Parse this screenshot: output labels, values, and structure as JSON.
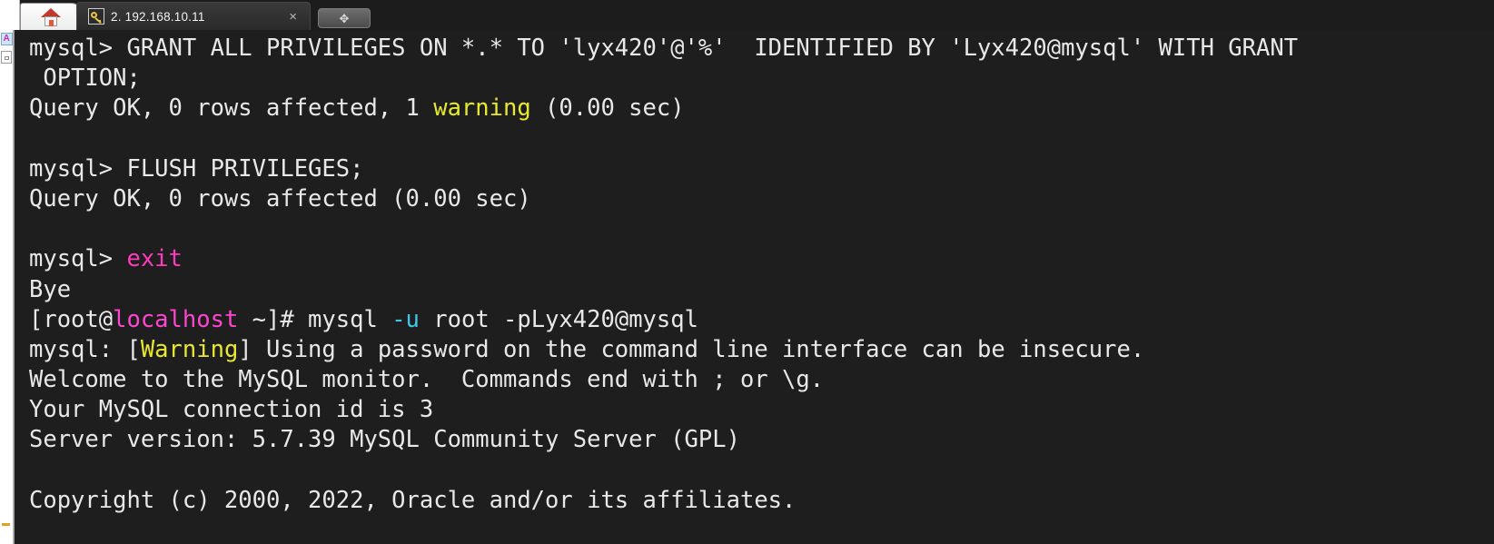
{
  "window": {
    "background_color": "#1c1c1c",
    "terminal_bg": "#1e1e1e",
    "terminal_fg": "#e6e6e6"
  },
  "tabbar": {
    "home_tab": {
      "label": "",
      "icon": "home-icon",
      "tooltip": "Home"
    },
    "session_tab": {
      "label": "2. 192.168.10.11",
      "icon": "key-icon",
      "close_label": "×",
      "active": true
    },
    "new_tab": {
      "label": "✥",
      "icon": "new-tab-icon"
    }
  },
  "sidebar": {
    "items": [
      {
        "name": "session-manager-icon",
        "label": "A"
      },
      {
        "name": "panel-icon",
        "label": ""
      }
    ]
  },
  "terminal": {
    "lines": [
      {
        "id": "line-grant",
        "segments": [
          {
            "text": "mysql> GRANT ALL PRIVILEGES ON *.* TO 'lyx420'@'%'  IDENTIFIED BY 'Lyx420@mysql' WITH GRANT",
            "color": "white"
          }
        ]
      },
      {
        "id": "line-grant-wrap",
        "segments": [
          {
            "text": " OPTION;",
            "color": "white"
          }
        ]
      },
      {
        "id": "line-queryok-warning",
        "segments": [
          {
            "text": "Query OK, 0 rows affected, 1 ",
            "color": "white"
          },
          {
            "text": "warning",
            "color": "yellow"
          },
          {
            "text": " (0.00 sec)",
            "color": "white"
          }
        ]
      },
      {
        "id": "line-blank-1",
        "segments": [
          {
            "text": "",
            "color": "white"
          }
        ]
      },
      {
        "id": "line-flush",
        "segments": [
          {
            "text": "mysql> FLUSH PRIVILEGES;",
            "color": "white"
          }
        ]
      },
      {
        "id": "line-queryok-flush",
        "segments": [
          {
            "text": "Query OK, 0 rows affected (0.00 sec)",
            "color": "white"
          }
        ]
      },
      {
        "id": "line-blank-2",
        "segments": [
          {
            "text": "",
            "color": "white"
          }
        ]
      },
      {
        "id": "line-exit",
        "segments": [
          {
            "text": "mysql> ",
            "color": "white"
          },
          {
            "text": "exit",
            "color": "pinkcmd"
          }
        ]
      },
      {
        "id": "line-bye",
        "segments": [
          {
            "text": "Bye",
            "color": "white"
          }
        ]
      },
      {
        "id": "line-shell-prompt",
        "segments": [
          {
            "text": "[root@",
            "color": "white"
          },
          {
            "text": "localhost",
            "color": "magenta"
          },
          {
            "text": " ~]# mysql ",
            "color": "white"
          },
          {
            "text": "-u",
            "color": "cyan"
          },
          {
            "text": " root -pLyx420@mysql",
            "color": "white"
          }
        ]
      },
      {
        "id": "line-mysql-warning",
        "segments": [
          {
            "text": "mysql: [",
            "color": "white"
          },
          {
            "text": "Warning",
            "color": "yellow"
          },
          {
            "text": "] Using a password on the command line interface can be insecure.",
            "color": "white"
          }
        ]
      },
      {
        "id": "line-welcome",
        "segments": [
          {
            "text": "Welcome to the MySQL monitor.  Commands end with ; or \\g.",
            "color": "white"
          }
        ]
      },
      {
        "id": "line-connid",
        "segments": [
          {
            "text": "Your MySQL connection id is 3",
            "color": "white"
          }
        ]
      },
      {
        "id": "line-serverversion",
        "segments": [
          {
            "text": "Server version: 5.7.39 MySQL Community Server (GPL)",
            "color": "white"
          }
        ]
      },
      {
        "id": "line-blank-3",
        "segments": [
          {
            "text": "",
            "color": "white"
          }
        ]
      },
      {
        "id": "line-copyright",
        "segments": [
          {
            "text": "Copyright (c) 2000, 2022, Oracle and/or its affiliates.",
            "color": "white"
          }
        ]
      }
    ]
  }
}
